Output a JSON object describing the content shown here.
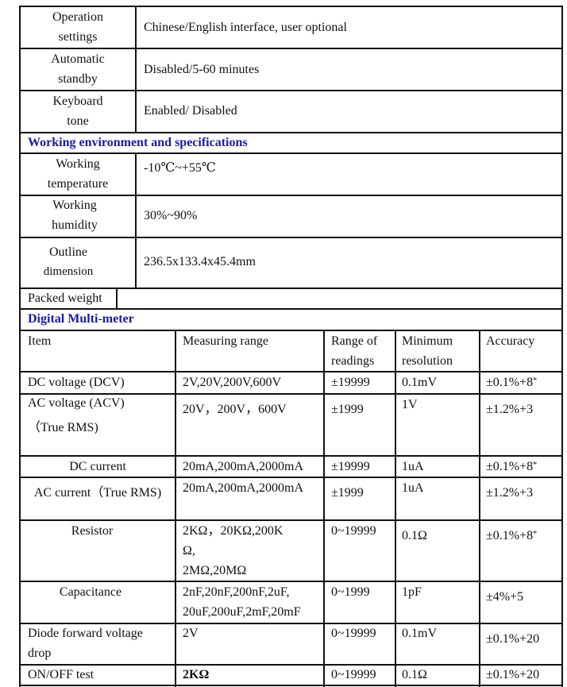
{
  "settings_rows": [
    {
      "label_l1": "Operation",
      "label_l2": "settings",
      "value": "Chinese/English interface, user optional"
    },
    {
      "label_l1": "Automatic",
      "label_l2": "standby",
      "value": "Disabled/5-60 minutes"
    },
    {
      "label_l1": "Keyboard",
      "label_l2": "tone",
      "value": "Enabled/ Disabled"
    }
  ],
  "section_env": {
    "title": "Working environment and specifications"
  },
  "env_rows": [
    {
      "label_l1": "Working",
      "label_l2": "temperature",
      "value": "-10℃~+55℃"
    },
    {
      "label_l1": "Working",
      "label_l2": "humidity",
      "value": "30%~90%"
    },
    {
      "label_l1": "Outline",
      "label_l2": "dimension",
      "value": "236.5x133.4x45.4mm"
    }
  ],
  "packed_weight": {
    "label": "Packed weight",
    "value": ""
  },
  "section_dmm": {
    "title": "Digital Multi-meter"
  },
  "dmm_table": {
    "headers": {
      "item": "Item",
      "range": "Measuring range",
      "readings_l1": "Range of",
      "readings_l2": "readings",
      "resolution_l1": "Minimum",
      "resolution_l2": "resolution",
      "accuracy": "Accuracy"
    },
    "rows": [
      {
        "item_l1": "DC voltage (DCV)",
        "item_l2": "",
        "range_l1": "2V,20V,200V,600V",
        "range_l2": "",
        "range_l3": "",
        "readings": "±19999",
        "resolution": "0.1mV",
        "accuracy": "±0.1%+8",
        "accuracy_mark": "*"
      },
      {
        "item_l1": "AC voltage (ACV)",
        "item_l2": "（True RMS)",
        "range_l1": "20V，200V，600V",
        "range_l2": "",
        "range_l3": "",
        "readings": "±1999",
        "resolution": "1V",
        "accuracy": "±1.2%+3",
        "accuracy_mark": ""
      },
      {
        "item_l1": "DC current",
        "item_l2": "",
        "range_l1": "20mA,200mA,2000mA",
        "range_l2": "",
        "range_l3": "",
        "readings": "±19999",
        "resolution": "1uA",
        "accuracy": "±0.1%+8",
        "accuracy_mark": "*"
      },
      {
        "item_l1": "AC current（True RMS)",
        "item_l2": "",
        "range_l1": "20mA,200mA,2000mA",
        "range_l2": "",
        "range_l3": "",
        "readings": "±1999",
        "resolution": "1uA",
        "accuracy": "±1.2%+3",
        "accuracy_mark": ""
      },
      {
        "item_l1": "Resistor",
        "item_l2": "",
        "range_l1": "2KΩ，20KΩ,200K",
        "range_l2": "Ω,",
        "range_l3": "2MΩ,20MΩ",
        "readings": "0~19999",
        "resolution": "0.1Ω",
        "accuracy": "±0.1%+8",
        "accuracy_mark": "*"
      },
      {
        "item_l1": "Capacitance",
        "item_l2": "",
        "range_l1": "2nF,20nF,200nF,2uF,",
        "range_l2": "20uF,200uF,2mF,20mF",
        "range_l3": "",
        "readings": "0~1999",
        "resolution": "1pF",
        "accuracy": "±4%+5",
        "accuracy_mark": ""
      },
      {
        "item_l1": "Diode forward voltage",
        "item_l2": "drop",
        "range_l1": "2V",
        "range_l2": "",
        "range_l3": "",
        "readings": "0~19999",
        "resolution": "0.1mV",
        "accuracy": "±0.1%+20",
        "accuracy_mark": ""
      },
      {
        "item_l1": "ON/OFF test",
        "item_l2": "",
        "range_l1": "2KΩ",
        "range_l2": "",
        "range_l3": "",
        "readings": "0~19999",
        "resolution": "0.1Ω",
        "accuracy": "±0.1%+20",
        "accuracy_mark": ""
      }
    ]
  }
}
